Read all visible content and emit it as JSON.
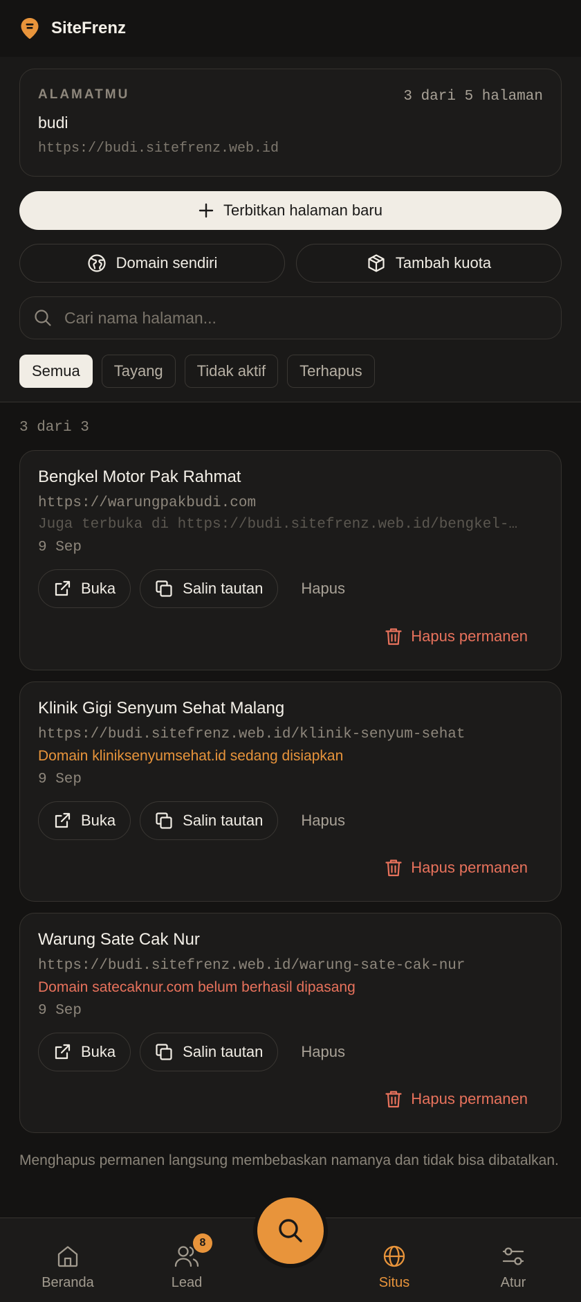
{
  "app": {
    "name": "SiteFrenz",
    "logo_icon": "pin-logo-icon",
    "accent": "#e8943b",
    "danger": "#e8725c"
  },
  "address": {
    "label": "ALAMATMU",
    "quota": "3 dari 5 halaman",
    "name": "budi",
    "url": "https://budi.sitefrenz.web.id"
  },
  "actions": {
    "publish": "Terbitkan halaman baru",
    "custom_domain": "Domain sendiri",
    "add_quota": "Tambah kuota"
  },
  "search": {
    "placeholder": "Cari nama halaman..."
  },
  "filters": {
    "selected": "Semua",
    "items": [
      "Semua",
      "Tayang",
      "Tidak aktif",
      "Terhapus"
    ]
  },
  "list": {
    "count": "3 dari 3",
    "open_label": "Buka",
    "copy_label": "Salin tautan",
    "delete_label": "Hapus",
    "perm_delete_label": "Hapus permanen",
    "sites": [
      {
        "title": "Bengkel Motor Pak Rahmat",
        "url": "https://warungpakbudi.com",
        "note": "Juga terbuka di https://budi.sitefrenz.web.id/bengkel-…",
        "note_type": "muted",
        "date": "9 Sep"
      },
      {
        "title": "Klinik Gigi Senyum Sehat Malang",
        "url": "https://budi.sitefrenz.web.id/klinik-senyum-sehat",
        "note": "Domain kliniksenyumsehat.id sedang disiapkan",
        "note_type": "orange",
        "date": "9 Sep"
      },
      {
        "title": "Warung Sate Cak Nur",
        "url": "https://budi.sitefrenz.web.id/warung-sate-cak-nur",
        "note": "Domain satecaknur.com belum berhasil dipasang",
        "note_type": "red",
        "date": "9 Sep"
      }
    ]
  },
  "footnote": "Menghapus permanen langsung membebaskan namanya dan tidak bisa dibatalkan.",
  "nav": {
    "items": [
      {
        "label": "Beranda",
        "icon": "home-icon"
      },
      {
        "label": "Lead",
        "icon": "users-icon",
        "badge": "8"
      },
      {
        "label": "Situs",
        "icon": "globe-icon",
        "active": true
      },
      {
        "label": "Atur",
        "icon": "sliders-icon"
      }
    ],
    "fab_icon": "search-icon"
  }
}
